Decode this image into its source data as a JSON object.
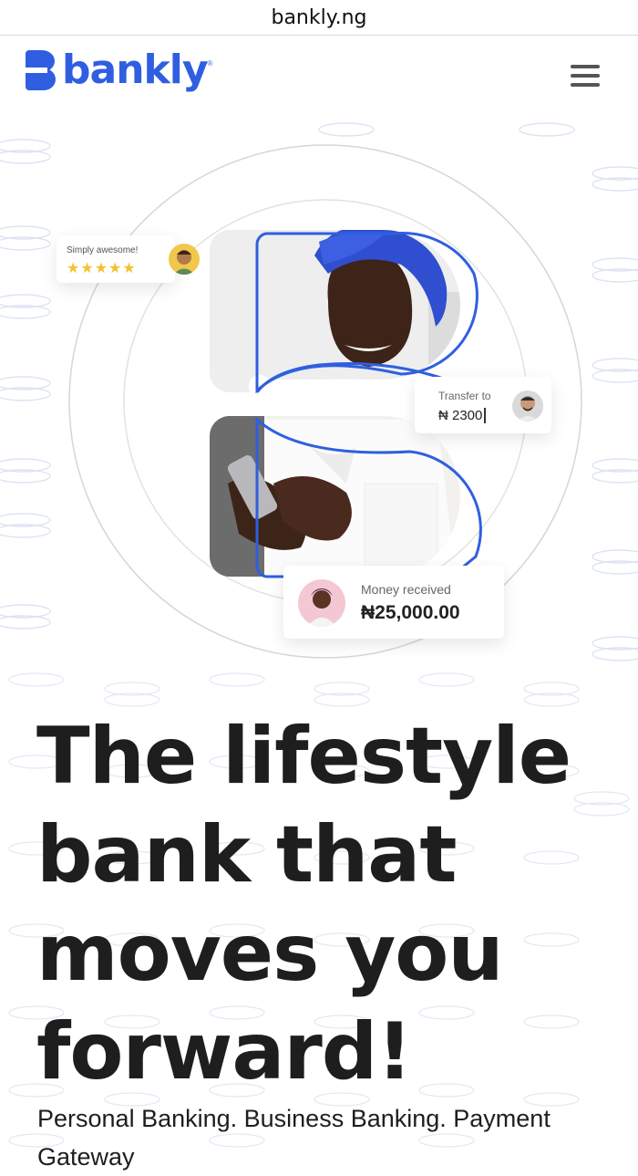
{
  "browser": {
    "url": "bankly.ng"
  },
  "header": {
    "brand_name": "bankly",
    "brand_reg": "®",
    "brand_color": "#2f5fe0",
    "menu_icon": "hamburger-menu-icon"
  },
  "hero": {
    "review_card": {
      "label": "Simply awesome!",
      "stars": "★★★★★",
      "rating": 5
    },
    "transfer_card": {
      "label": "Transfer to",
      "amount": "₦ 2300"
    },
    "money_card": {
      "label": "Money received",
      "amount": "₦25,000.00"
    }
  },
  "content": {
    "headline": "The lifestyle bank that moves you forward!",
    "subheadline": "Personal Banking. Business Banking. Payment Gateway"
  }
}
